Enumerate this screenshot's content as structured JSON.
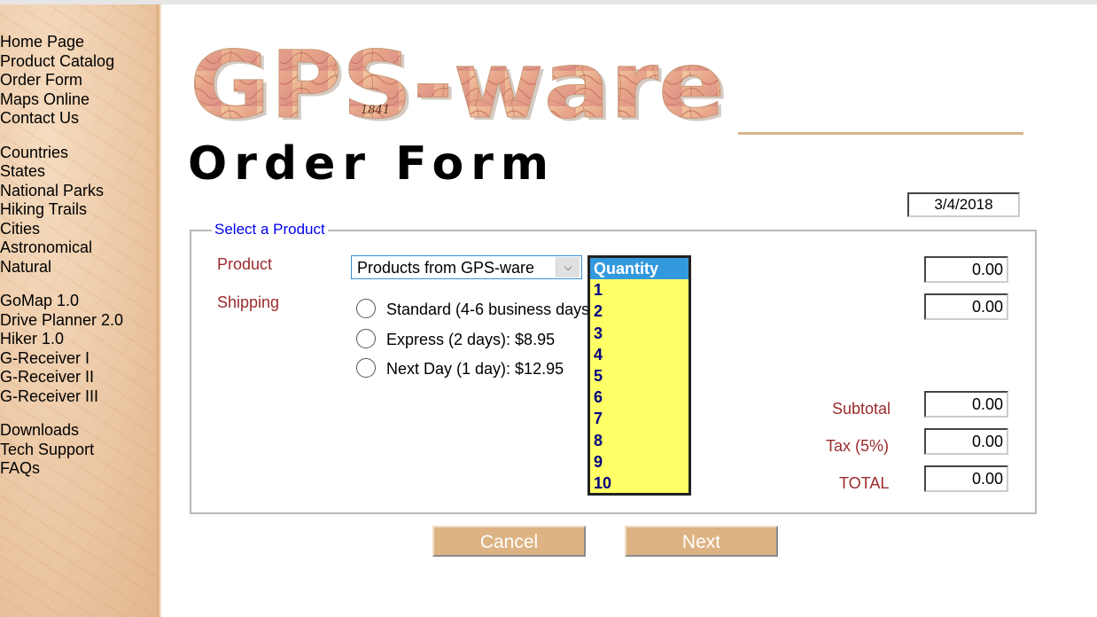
{
  "sidebar": {
    "groups": [
      [
        "Home Page",
        "Product Catalog",
        "Order Form",
        "Maps Online",
        "Contact Us"
      ],
      [
        "Countries",
        "States",
        "National Parks",
        "Hiking Trails",
        "Cities",
        "Astronomical",
        "Natural"
      ],
      [
        "GoMap 1.0",
        "Drive Planner 2.0",
        "Hiker 1.0",
        "G-Receiver I",
        "G-Receiver II",
        "G-Receiver III"
      ],
      [
        "Downloads",
        "Tech Support",
        "FAQs"
      ]
    ]
  },
  "logo": {
    "text": "GPS-ware",
    "stamp": "1841"
  },
  "page": {
    "title": "Order Form"
  },
  "date": "3/4/2018",
  "form": {
    "legend": "Select a Product",
    "product_label": "Product",
    "product_select": {
      "selected": "Products from GPS-ware"
    },
    "shipping_label": "Shipping",
    "shipping_options": [
      "Standard (4-6 business days)",
      "Express (2 days): $8.95",
      "Next Day (1 day): $12.95"
    ],
    "quantity_list": {
      "header": "Quantity",
      "options": [
        "1",
        "2",
        "3",
        "4",
        "5",
        "6",
        "7",
        "8",
        "9",
        "10"
      ]
    },
    "product_amount": "0.00",
    "shipping_amount": "0.00",
    "subtotal_label": "Subtotal",
    "subtotal": "0.00",
    "tax_label": "Tax (5%)",
    "tax": "0.00",
    "total_label": "TOTAL",
    "total": "0.00"
  },
  "buttons": {
    "cancel": "Cancel",
    "next": "Next"
  },
  "colors": {
    "label_red": "#9b2b2b",
    "legend_blue": "#0000ee",
    "list_yellow": "#ffff66",
    "list_selected": "#3399dd",
    "button_tan": "#ddb383"
  }
}
